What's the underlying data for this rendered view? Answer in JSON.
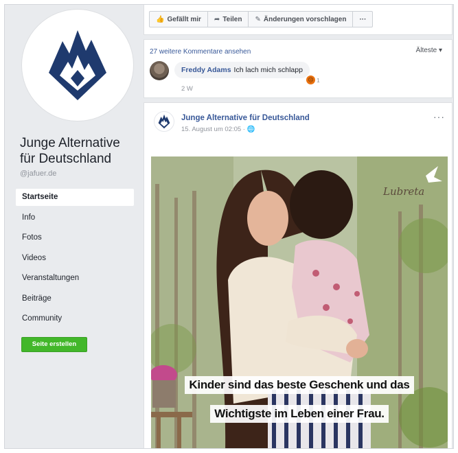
{
  "sidebar": {
    "page_name": "Junge Alternative für Deutschland",
    "handle": "@jafuer.de",
    "nav": [
      {
        "label": "Startseite",
        "active": true
      },
      {
        "label": "Info"
      },
      {
        "label": "Fotos"
      },
      {
        "label": "Videos"
      },
      {
        "label": "Veranstaltungen"
      },
      {
        "label": "Beiträge"
      },
      {
        "label": "Community"
      }
    ],
    "create_button": "Seite erstellen"
  },
  "actions": {
    "like": "Gefällt mir",
    "share": "Teilen",
    "suggest": "Änderungen vorschlagen",
    "more": "···"
  },
  "comments": {
    "more_link": "27 weitere Kommentare ansehen",
    "sort": "Älteste ▾",
    "item": {
      "author": "Freddy Adams",
      "text": "Ich lach mich schlapp",
      "time": "2 W",
      "reaction_count": "1"
    }
  },
  "post": {
    "author": "Junge Alternative für Deutschland",
    "date": "15. August um 02:05 · ",
    "menu": "···",
    "image": {
      "brand": "Lubreta",
      "caption_line1": "Kinder sind das beste Geschenk und das",
      "caption_line2": "Wichtigste im Leben einer Frau."
    }
  },
  "colors": {
    "brand_blue": "#1f3a6e",
    "link": "#385898",
    "create": "#42b72a"
  }
}
